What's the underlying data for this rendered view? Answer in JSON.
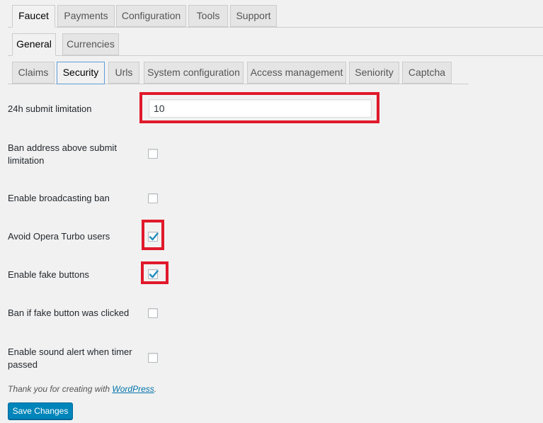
{
  "tabs_main": [
    "Faucet",
    "Payments",
    "Configuration",
    "Tools",
    "Support"
  ],
  "tabs_sub": [
    "General",
    "Currencies"
  ],
  "tabs_section": [
    "Claims",
    "Security",
    "Urls",
    "System configuration",
    "Access management",
    "Seniority",
    "Captcha"
  ],
  "fields": {
    "submit_limit": {
      "label": "24h submit limitation",
      "value": "10"
    },
    "ban_above_limit": {
      "label": "Ban address above submit limitation",
      "checked": false
    },
    "broadcast_ban": {
      "label": "Enable broadcasting ban",
      "checked": false
    },
    "opera_turbo": {
      "label": "Avoid Opera Turbo users",
      "checked": true
    },
    "fake_buttons": {
      "label": "Enable fake buttons",
      "checked": true
    },
    "ban_fake_click": {
      "label": "Ban if fake button was clicked",
      "checked": false
    },
    "sound_alert": {
      "label": "Enable sound alert when timer passed",
      "checked": false
    }
  },
  "footer": {
    "prefix": "Thank you for creating with ",
    "link": "WordPress",
    "suffix": "."
  },
  "save_label": "Save Changes",
  "colors": {
    "accent": "#0085ba",
    "highlight": "#e0192a",
    "check": "#1e8cbe"
  }
}
